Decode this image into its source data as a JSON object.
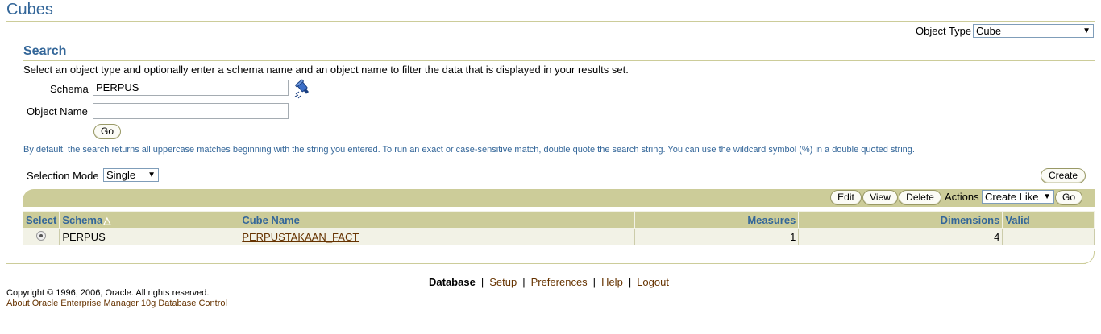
{
  "page": {
    "title": "Cubes"
  },
  "object_type": {
    "label": "Object Type",
    "value": "Cube"
  },
  "search": {
    "title": "Search",
    "instructions": "Select an object type and optionally enter a schema name and an object name to filter the data that is displayed in your results set.",
    "schema_label": "Schema",
    "schema_value": "PERPUS",
    "object_name_label": "Object Name",
    "object_name_value": "",
    "go_label": "Go",
    "hint": "By default, the search returns all uppercase matches beginning with the string you entered. To run an exact or case-sensitive match, double quote the search string. You can use the wildcard symbol (%) in a double quoted string."
  },
  "selection": {
    "label": "Selection Mode",
    "value": "Single"
  },
  "toolbar": {
    "create_label": "Create",
    "edit_label": "Edit",
    "view_label": "View",
    "delete_label": "Delete",
    "actions_label": "Actions",
    "actions_value": "Create Like",
    "go_label": "Go"
  },
  "table": {
    "headers": {
      "select": "Select",
      "schema": "Schema",
      "cube_name": "Cube Name",
      "measures": "Measures",
      "dimensions": "Dimensions",
      "valid": "Valid"
    },
    "rows": [
      {
        "schema": "PERPUS",
        "cube_name": "PERPUSTAKAAN_FACT",
        "measures": "1",
        "dimensions": "4",
        "valid": ""
      }
    ]
  },
  "footer": {
    "links": [
      "Database",
      "Setup",
      "Preferences",
      "Help",
      "Logout"
    ],
    "separator": "|",
    "copyright": "Copyright © 1996, 2006, Oracle. All rights reserved.",
    "about": "About Oracle Enterprise Manager 10g Database Control"
  },
  "icons": {
    "flashlight": "flashlight-icon",
    "sort_ascending": "sort-ascending-icon",
    "dropdown": "chevron-down-icon"
  },
  "colors": {
    "accent": "#336699",
    "bar": "#cccc99",
    "link": "#663300"
  }
}
